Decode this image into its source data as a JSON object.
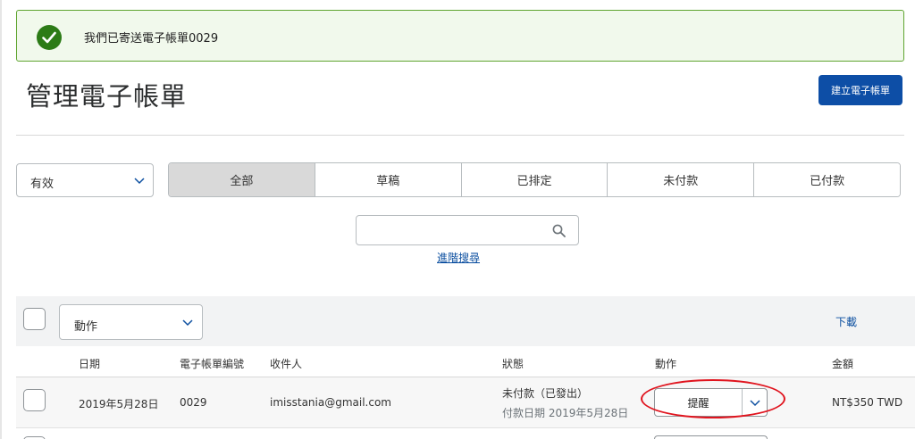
{
  "alert": {
    "message": "我們已寄送電子帳單0029",
    "icon": "check-circle-icon",
    "color": "#2c7b16"
  },
  "header": {
    "title": "管理電子帳單",
    "create_button": "建立電子帳單"
  },
  "filters": {
    "status_select": {
      "value": "有效",
      "icon": "chevron-down-icon"
    },
    "tabs": [
      {
        "label": "全部",
        "active": true
      },
      {
        "label": "草稿",
        "active": false
      },
      {
        "label": "已排定",
        "active": false
      },
      {
        "label": "未付款",
        "active": false
      },
      {
        "label": "已付款",
        "active": false
      }
    ]
  },
  "search": {
    "placeholder": "",
    "icon": "search-icon",
    "advanced_link": "進階搜尋"
  },
  "toolbar": {
    "action_select": "動作",
    "download_link": "下載"
  },
  "table": {
    "columns": [
      "日期",
      "電子帳單編號",
      "收件人",
      "狀態",
      "動作",
      "金額"
    ],
    "rows": [
      {
        "date": "2019年5月28日",
        "invoice_no": "0029",
        "recipient": "imisstania@gmail.com",
        "status": "未付款（已發出）",
        "status_sub": "付款日期 2019年5月28日",
        "action": "提醒",
        "amount": "NT$350 TWD"
      }
    ]
  },
  "colors": {
    "primary": "#0d4ea6",
    "link": "#0c4fa0",
    "success_border": "#5fa530",
    "annotation": "#e0141e"
  }
}
